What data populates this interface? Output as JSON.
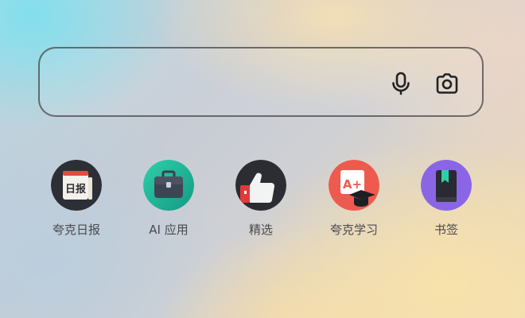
{
  "search": {
    "value": "",
    "placeholder": "",
    "mic_icon": "microphone-icon",
    "camera_icon": "camera-icon"
  },
  "shortcuts": [
    {
      "label": "夸克日报",
      "icon": "daily-news-icon",
      "icon_text": "日报",
      "color": "#2d2f36"
    },
    {
      "label": "AI 应用",
      "icon": "briefcase-icon",
      "color": "#1fb49a"
    },
    {
      "label": "精选",
      "icon": "thumbs-up-icon",
      "color": "#2b2d33"
    },
    {
      "label": "夸克学习",
      "icon": "grade-a-plus-icon",
      "icon_text": "A+",
      "color": "#ef5a4f"
    },
    {
      "label": "书签",
      "icon": "bookmark-icon",
      "color": "#8a66e6"
    }
  ]
}
